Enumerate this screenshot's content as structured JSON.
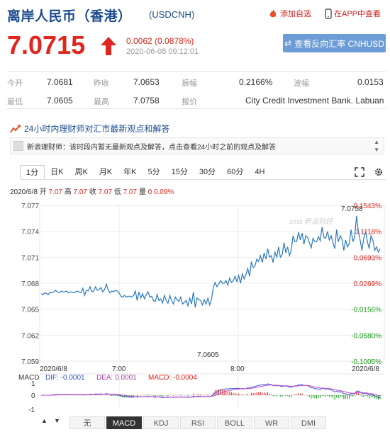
{
  "header": {
    "title": "离岸人民币（香港）",
    "symbol": "(USDCNH)",
    "add_watch": "添加自选",
    "app_view": "在APP中查看",
    "price": "7.0715",
    "change": "0.0062 (0.0878%)",
    "timestamp": "2020-06-08 09:12:01",
    "reverse_button": "查看反向汇率 CNHUSD"
  },
  "stats": {
    "open_label": "今开",
    "open": "7.0681",
    "prev_label": "昨收",
    "prev": "7.0653",
    "amp_label": "振幅",
    "amp": "0.2166%",
    "wave_label": "波幅",
    "wave": "0.0153",
    "low_label": "最低",
    "low": "7.0605",
    "high_label": "最高",
    "high": "7.0758",
    "quote_label": "报价",
    "quote": "City Credit Investment Bank. Labuan"
  },
  "expert": {
    "title": "24小时内理财师对汇市最新观点和解答",
    "message": "新浪理财师：该时段内暂无最新观点及解答，点击查看24小时之前的观点及解答"
  },
  "tabs": [
    "1分",
    "日K",
    "周K",
    "月K",
    "年K",
    "5分",
    "15分",
    "30分",
    "60分",
    "4H"
  ],
  "quote_line": {
    "date": "2020/6/8",
    "open_l": "开",
    "open_v": "7.07",
    "high_l": "高",
    "high_v": "7.07",
    "close_l": "收",
    "close_v": "7.07",
    "low_l": "低",
    "low_v": "7.07",
    "vol_l": "量",
    "vol_v": "0",
    "pct": "0.09%"
  },
  "chart_data": {
    "type": "line",
    "y_ticks": [
      "7.077",
      "7.074",
      "7.071",
      "7.068",
      "7.065",
      "7.062",
      "7.059"
    ],
    "pct_ticks": [
      "0.1543%",
      "0.1118%",
      "0.0693%",
      "0.0269%",
      "-0.0156%",
      "-0.0580%",
      "-0.1005%"
    ],
    "x_ticks": [
      "2020/6/8",
      "7:00",
      "8:00",
      "2020/6/8"
    ],
    "high_label": "7.0758",
    "low_label": "7.0605",
    "ylim": [
      7.059,
      7.077
    ],
    "watermark": "sina 新浪财经",
    "values": [
      7.0668,
      7.0667,
      7.0669,
      7.0668,
      7.0667,
      7.067,
      7.0669,
      7.067,
      7.0672,
      7.067,
      7.0669,
      7.0671,
      7.067,
      7.067,
      7.0671,
      7.0669,
      7.067,
      7.067,
      7.0669,
      7.067,
      7.0671,
      7.067,
      7.0669,
      7.0674,
      7.0666,
      7.0672,
      7.0671,
      7.0676,
      7.067,
      7.0671,
      7.0676,
      7.0672,
      7.0673,
      7.0675,
      7.067,
      7.0673,
      7.0679,
      7.0672,
      7.0669,
      7.0671,
      7.067,
      7.0672,
      7.0671,
      7.0669,
      7.0665,
      7.0664,
      7.0666,
      7.0664,
      7.0665,
      7.0665,
      7.0664,
      7.0666,
      7.0671,
      7.066,
      7.067,
      7.0663,
      7.0668,
      7.0662,
      7.0667,
      7.067,
      7.0664,
      7.0665,
      7.066,
      7.0659,
      7.0667,
      7.066,
      7.0662,
      7.0657,
      7.0666,
      7.066,
      7.0657,
      7.0666,
      7.066,
      7.0656,
      7.0664,
      7.0661,
      7.0659,
      7.0664,
      7.0656,
      7.0658,
      7.066,
      7.0654,
      7.0663,
      7.0656,
      7.067,
      7.0652,
      7.0663,
      7.0661,
      7.066,
      7.0655,
      7.0661,
      7.0656,
      7.0663,
      7.0655,
      7.0662,
      7.0675,
      7.0681,
      7.0676,
      7.0679,
      7.0683,
      7.068,
      7.068,
      7.0683,
      7.0678,
      7.0686,
      7.0681,
      7.0683,
      7.0688,
      7.0682,
      7.0689,
      7.068,
      7.0691,
      7.0685,
      7.069,
      7.0697,
      7.0688,
      7.0705,
      7.0698,
      7.07,
      7.0708,
      7.0705,
      7.0712,
      7.0704,
      7.0715,
      7.0708,
      7.072,
      7.071,
      7.0712,
      7.0704,
      7.0716,
      7.071,
      7.0722,
      7.071,
      7.0713,
      7.0727,
      7.0715,
      7.0722,
      7.0712,
      7.0718,
      7.0735,
      7.0728,
      7.0728,
      7.0739,
      7.073,
      7.0738,
      7.0725,
      7.0735,
      7.0733,
      7.0727,
      7.0721,
      7.0732,
      7.0728,
      7.0728,
      7.0734,
      7.0729,
      7.0745,
      7.0733,
      7.0732,
      7.074,
      7.073,
      7.0735,
      7.0727,
      7.072,
      7.0742,
      7.0728,
      7.0735,
      7.0731,
      7.0718,
      7.073,
      7.0722,
      7.0726,
      7.0742,
      7.0728,
      7.0734,
      7.0758,
      7.074,
      7.073,
      7.0718,
      7.0732,
      7.074,
      7.0728,
      7.072,
      7.0735,
      7.073,
      7.0718,
      7.0722,
      7.0716,
      7.072
    ]
  },
  "macd": {
    "label": "MACD",
    "dif": "DIF: -0.0001",
    "dea": "DEA: 0.0001",
    "macd": "MACD: -0.0004",
    "y_ticks": [
      "1",
      "0",
      "-1"
    ]
  },
  "indicators": [
    "无",
    "MACD",
    "KDJ",
    "RSI",
    "BOLL",
    "WR",
    "DMI"
  ],
  "colors": {
    "accent_red": "#e0261e",
    "brand_blue": "#1a4a8f",
    "line": "#2a78c2",
    "green": "#1aa01a"
  }
}
